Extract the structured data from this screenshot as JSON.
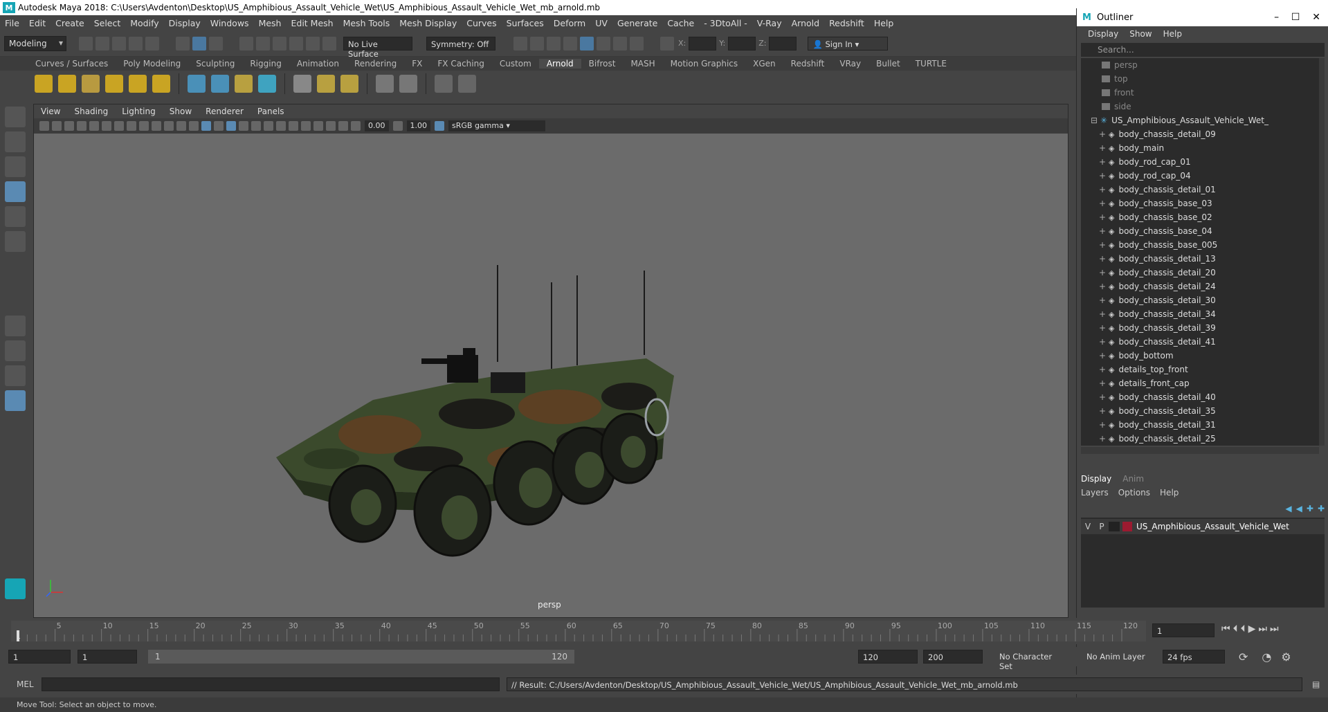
{
  "window": {
    "title": "Autodesk Maya 2018: C:\\Users\\Avdenton\\Desktop\\US_Amphibious_Assault_Vehicle_Wet\\US_Amphibious_Assault_Vehicle_Wet_mb_arnold.mb"
  },
  "menubar": [
    "File",
    "Edit",
    "Create",
    "Select",
    "Modify",
    "Display",
    "Windows",
    "Mesh",
    "Edit Mesh",
    "Mesh Tools",
    "Mesh Display",
    "Curves",
    "Surfaces",
    "Deform",
    "UV",
    "Generate",
    "Cache",
    "- 3DtoAll -",
    "V-Ray",
    "Arnold",
    "Redshift",
    "Help"
  ],
  "toolbar": {
    "mode": "Modeling",
    "live_surface": "No Live Surface",
    "symmetry": "Symmetry: Off",
    "x_label": "X:",
    "y_label": "Y:",
    "z_label": "Z:",
    "sign_in": "Sign In"
  },
  "shelf_tabs": [
    "Curves / Surfaces",
    "Poly Modeling",
    "Sculpting",
    "Rigging",
    "Animation",
    "Rendering",
    "FX",
    "FX Caching",
    "Custom",
    "Arnold",
    "Bifrost",
    "MASH",
    "Motion Graphics",
    "XGen",
    "Redshift",
    "VRay",
    "Bullet",
    "TURTLE"
  ],
  "shelf_active": "Arnold",
  "viewport": {
    "menu": [
      "View",
      "Shading",
      "Lighting",
      "Show",
      "Renderer",
      "Panels"
    ],
    "exposure": "0.00",
    "gamma": "1.00",
    "color_space": "sRGB gamma",
    "camera_label": "persp"
  },
  "outliner": {
    "title": "Outliner",
    "menu": [
      "Display",
      "Show",
      "Help"
    ],
    "search_placeholder": "Search...",
    "cameras": [
      "persp",
      "top",
      "front",
      "side"
    ],
    "group": "US_Amphibious_Assault_Vehicle_Wet_",
    "items": [
      "body_chassis_detail_09",
      "body_main",
      "body_rod_cap_01",
      "body_rod_cap_04",
      "body_chassis_detail_01",
      "body_chassis_base_03",
      "body_chassis_base_02",
      "body_chassis_base_04",
      "body_chassis_base_005",
      "body_chassis_detail_13",
      "body_chassis_detail_20",
      "body_chassis_detail_24",
      "body_chassis_detail_30",
      "body_chassis_detail_34",
      "body_chassis_detail_39",
      "body_chassis_detail_41",
      "body_bottom",
      "details_top_front",
      "details_front_cap",
      "body_chassis_detail_40",
      "body_chassis_detail_35",
      "body_chassis_detail_31",
      "body_chassis_detail_25"
    ]
  },
  "layers": {
    "tabs": [
      "Display",
      "Anim"
    ],
    "menu": [
      "Layers",
      "Options",
      "Help"
    ],
    "row": {
      "v": "V",
      "p": "P",
      "name": "US_Amphibious_Assault_Vehicle_Wet",
      "color": "#9b1b30"
    }
  },
  "timeline": {
    "ticks": [
      "5",
      "10",
      "15",
      "20",
      "25",
      "30",
      "35",
      "40",
      "45",
      "50",
      "55",
      "60",
      "65",
      "70",
      "75",
      "80",
      "85",
      "90",
      "95",
      "100",
      "105",
      "110",
      "115",
      "120"
    ],
    "current_frame": "1",
    "first_tick": "1"
  },
  "range": {
    "start": "1",
    "start2": "1",
    "slider_start": "1",
    "slider_end": "120",
    "end": "120",
    "end2": "200",
    "character_set": "No Character Set",
    "anim_layer": "No Anim Layer",
    "fps": "24 fps"
  },
  "command": {
    "mel_label": "MEL",
    "result": "// Result: C:/Users/Avdenton/Desktop/US_Amphibious_Assault_Vehicle_Wet/US_Amphibious_Assault_Vehicle_Wet_mb_arnold.mb"
  },
  "help_line": "Move Tool: Select an object to move.",
  "colors": {
    "accent": "#5a8ab3",
    "maya_logo": "#16a5b5",
    "layer_color": "#9b1b30"
  }
}
